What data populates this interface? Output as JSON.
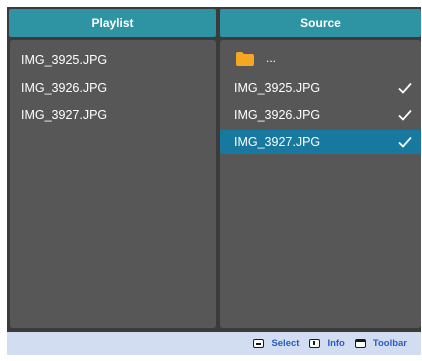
{
  "headers": {
    "playlist": "Playlist",
    "source": "Source"
  },
  "playlist": {
    "items": [
      {
        "label": "IMG_3925.JPG"
      },
      {
        "label": "IMG_3926.JPG"
      },
      {
        "label": "IMG_3927.JPG"
      }
    ]
  },
  "source": {
    "parent_label": "...",
    "items": [
      {
        "label": "IMG_3925.JPG",
        "checked": true,
        "selected": false
      },
      {
        "label": "IMG_3926.JPG",
        "checked": true,
        "selected": false
      },
      {
        "label": "IMG_3927.JPG",
        "checked": true,
        "selected": true
      }
    ]
  },
  "footer": {
    "select": "Select",
    "info": "Info",
    "toolbar": "Toolbar"
  },
  "icons": [
    "folder-icon",
    "checkmark-icon",
    "select-icon",
    "info-icon",
    "toolbar-icon"
  ],
  "colors": {
    "header": "#2e94a4",
    "panel": "#575757",
    "background": "#3b3b3b",
    "selected_row": "#17799f",
    "footer": "#d2ddf2",
    "footer_text": "#2a5cc4",
    "folder": "#f5a623"
  }
}
